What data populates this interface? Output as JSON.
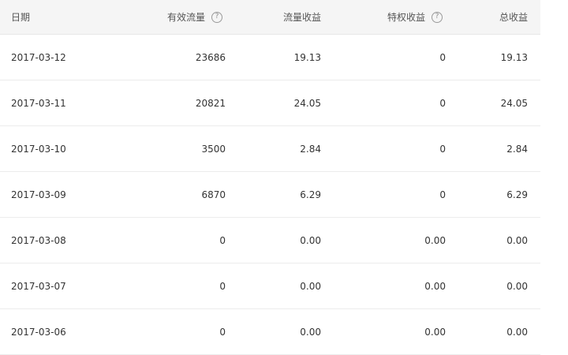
{
  "columns": {
    "date": "日期",
    "valid_traffic": "有效流量",
    "traffic_revenue": "流量收益",
    "privilege_revenue": "特权收益",
    "total_revenue": "总收益"
  },
  "rows": [
    {
      "date": "2017-03-12",
      "valid_traffic": "23686",
      "traffic_revenue": "19.13",
      "privilege_revenue": "0",
      "total_revenue": "19.13"
    },
    {
      "date": "2017-03-11",
      "valid_traffic": "20821",
      "traffic_revenue": "24.05",
      "privilege_revenue": "0",
      "total_revenue": "24.05"
    },
    {
      "date": "2017-03-10",
      "valid_traffic": "3500",
      "traffic_revenue": "2.84",
      "privilege_revenue": "0",
      "total_revenue": "2.84"
    },
    {
      "date": "2017-03-09",
      "valid_traffic": "6870",
      "traffic_revenue": "6.29",
      "privilege_revenue": "0",
      "total_revenue": "6.29"
    },
    {
      "date": "2017-03-08",
      "valid_traffic": "0",
      "traffic_revenue": "0.00",
      "privilege_revenue": "0.00",
      "total_revenue": "0.00"
    },
    {
      "date": "2017-03-07",
      "valid_traffic": "0",
      "traffic_revenue": "0.00",
      "privilege_revenue": "0.00",
      "total_revenue": "0.00"
    },
    {
      "date": "2017-03-06",
      "valid_traffic": "0",
      "traffic_revenue": "0.00",
      "privilege_revenue": "0.00",
      "total_revenue": "0.00"
    }
  ],
  "icons": {
    "help": "question-circle-icon"
  },
  "colors": {
    "header_bg": "#f5f5f5",
    "border": "#ececec",
    "text": "#333333"
  }
}
